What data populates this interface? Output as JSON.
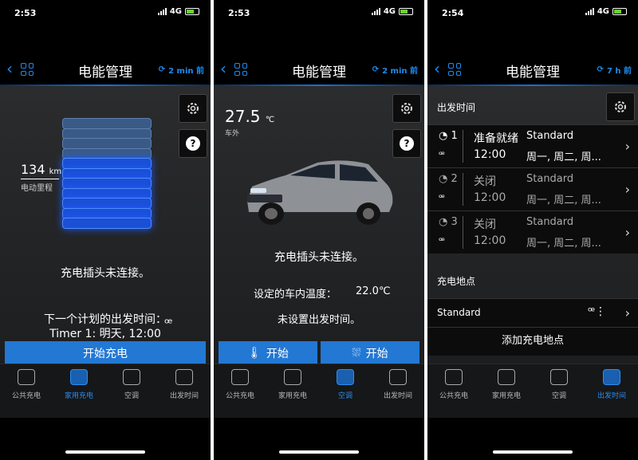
{
  "screens": [
    {
      "status": {
        "time": "2:53",
        "network": "4G"
      },
      "nav": {
        "title": "电能管理",
        "refresh": "2 min 前"
      },
      "range": {
        "value": "134",
        "unit": "km",
        "label": "电动里程"
      },
      "message": "充电插头未连接。",
      "next_departure": {
        "label": "下一个计划的出发时间：",
        "value": "Timer 1: 明天, 12:00"
      },
      "start_button": "开始充电"
    },
    {
      "status": {
        "time": "2:53",
        "network": "4G"
      },
      "nav": {
        "title": "电能管理",
        "refresh": "2 min 前"
      },
      "temperature": {
        "value": "27.5",
        "unit": "℃",
        "label": "车外"
      },
      "message": "充电插头未连接。",
      "set_temp": {
        "label": "设定的车内温度：",
        "value": "22.0℃"
      },
      "no_departure": "未设置出发时间。",
      "start_left": "开始",
      "start_right": "开始"
    },
    {
      "status": {
        "time": "2:54",
        "network": "4G"
      },
      "nav": {
        "title": "电能管理",
        "refresh": "7 h 前"
      },
      "departure_header": "出发时间",
      "timers": [
        {
          "num": "1",
          "state": "准备就绪",
          "time": "12:00",
          "profile": "Standard",
          "days": "周一, 周二, 周..."
        },
        {
          "num": "2",
          "state": "关闭",
          "time": "12:00",
          "profile": "Standard",
          "days": "周一, 周二, 周..."
        },
        {
          "num": "3",
          "state": "关闭",
          "time": "12:00",
          "profile": "Standard",
          "days": "周一, 周二, 周..."
        }
      ],
      "location_header": "充电地点",
      "location": "Standard",
      "add_location": "添加充电地点"
    }
  ],
  "tabs": [
    "公共充电",
    "家用充电",
    "空调",
    "出发时间"
  ],
  "active_tabs": [
    1,
    2,
    3
  ],
  "colors": {
    "accent": "#2378d4",
    "glow": "#1f5cff"
  }
}
